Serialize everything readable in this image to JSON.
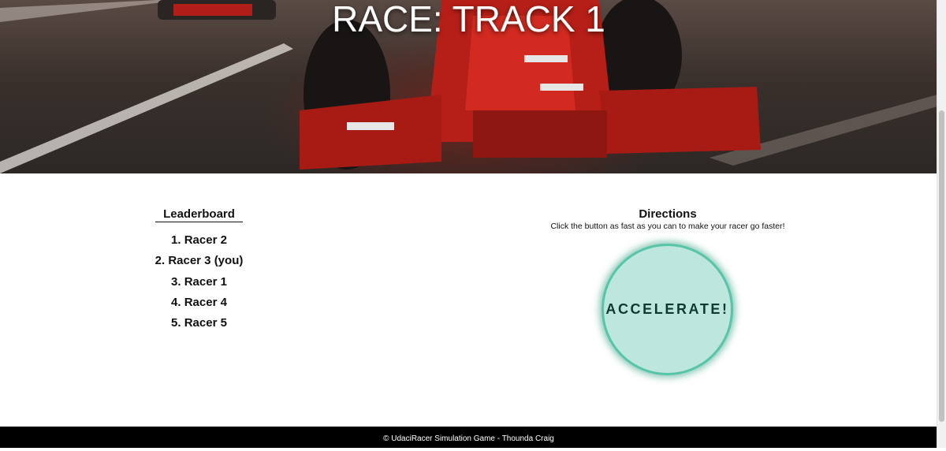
{
  "hero": {
    "title": "RACE: TRACK 1"
  },
  "leaderboard": {
    "title": "Leaderboard",
    "items": [
      "1. Racer 2",
      "2. Racer 3 (you)",
      "3. Racer 1",
      "4. Racer 4",
      "5. Racer 5"
    ]
  },
  "directions": {
    "title": "Directions",
    "text": "Click the button as fast as you can to make your racer go faster!"
  },
  "accelerate_button": {
    "label": "ACCELERATE!"
  },
  "footer": {
    "text": "© UdaciRacer Simulation Game - Thounda Craig"
  },
  "colors": {
    "accent": "#bde7dd",
    "accent_border": "#58c4aa",
    "footer_bg": "#000000",
    "car_red": "#c0231b"
  }
}
